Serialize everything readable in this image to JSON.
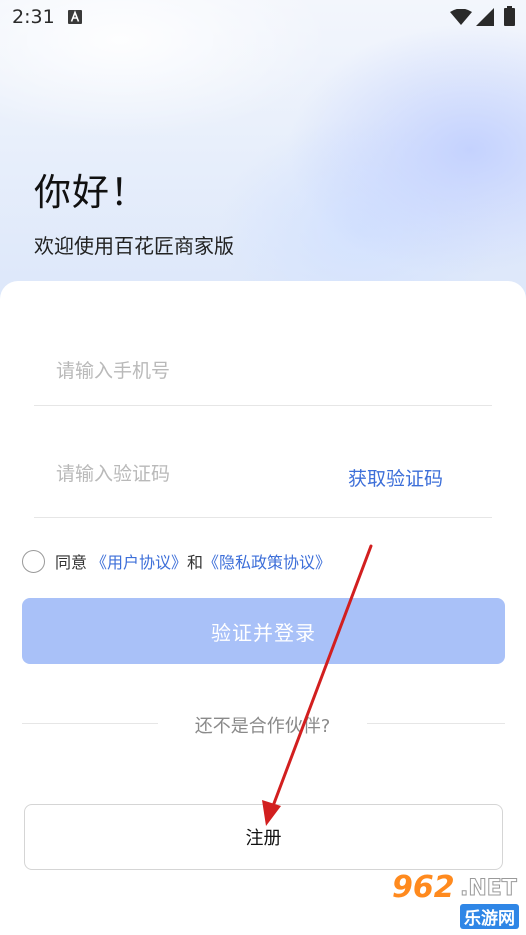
{
  "status_bar": {
    "time": "2:31"
  },
  "header": {
    "greeting": "你好！",
    "welcome": "欢迎使用百花匠商家版"
  },
  "form": {
    "phone_placeholder": "请输入手机号",
    "code_placeholder": "请输入验证码",
    "get_code_label": "获取验证码",
    "agree_prefix": "同意",
    "user_agreement": "《用户协议》",
    "and_text": "和",
    "privacy_policy": "《隐私政策协议》",
    "login_label": "验证并登录"
  },
  "partner": {
    "prompt": "还不是合作伙伴?",
    "register_label": "注册"
  },
  "watermark": {
    "number": "962",
    "net": ".NET",
    "site": "乐游网"
  },
  "colors": {
    "accent": "#3d6fd9",
    "login_button_bg": "#a9c1f8",
    "annotation_arrow": "#d21f1f"
  }
}
